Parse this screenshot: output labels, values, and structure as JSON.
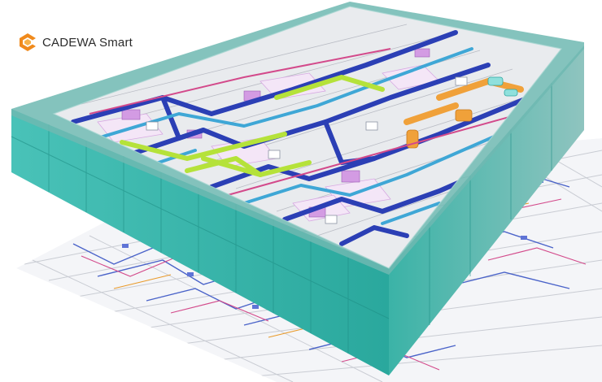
{
  "brand": {
    "name": "CADEWA Smart",
    "logo_icon": "cadewa-logo-icon",
    "accent_color": "#f08a1c"
  },
  "scene": {
    "description_icon": "bim-building-model-icon",
    "colors": {
      "curtain_wall": "#2fb3a8",
      "duct_blue": "#2b3fb5",
      "duct_cyan": "#3fa7d6",
      "pipe_green": "#b5e23a",
      "pipe_orange": "#f0a13a",
      "unit_violet": "#d9a6e8",
      "drawing_lines": "#8fa1c6"
    }
  }
}
